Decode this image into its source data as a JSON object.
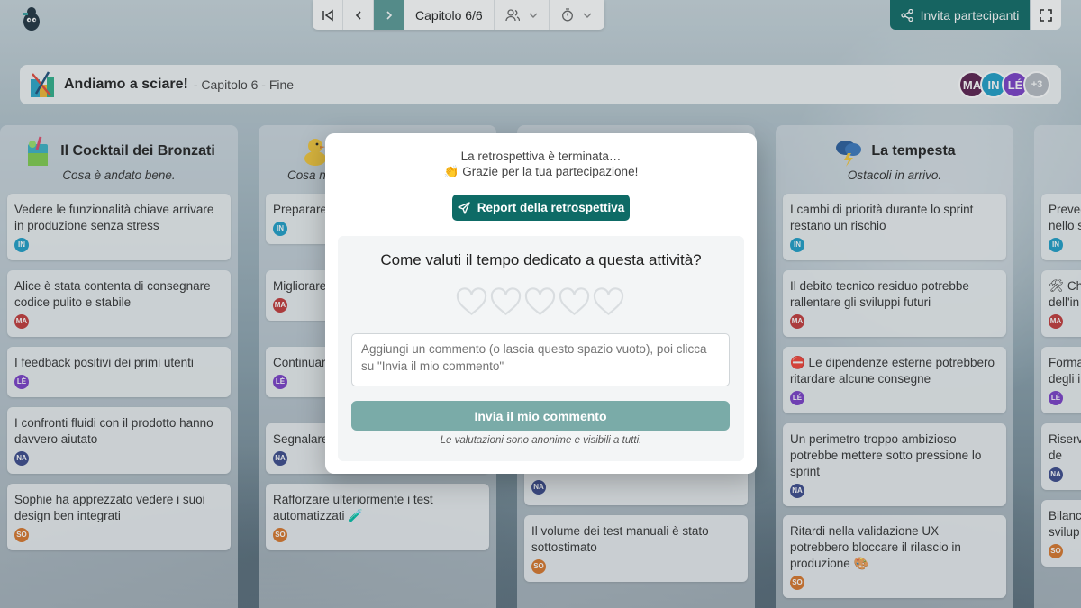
{
  "nav": {
    "chapter": "Capitolo 6/6",
    "invite_label": "Invita partecipanti"
  },
  "title": {
    "name": "Andiamo a sciare!",
    "subtitle": "- Capitolo 6 - Fine"
  },
  "participants": [
    "MA",
    "IN",
    "LÉ"
  ],
  "participants_more": "+3",
  "columns": [
    {
      "title": "Il Cocktail dei Bronzati",
      "subtitle": "Cosa è andato bene.",
      "cards": [
        {
          "text": "Vedere le funzionalità chiave arrivare in produzione senza stress",
          "author": "IN"
        },
        {
          "text": "Alice è stata contenta di consegnare codice pulito e stabile",
          "author": "MA"
        },
        {
          "text": "I feedback positivi dei primi utenti",
          "author": "LÉ"
        },
        {
          "text": "I confronti fluidi con il prodotto hanno davvero aiutato",
          "author": "NA"
        },
        {
          "text": "Sophie ha apprezzato vedere i suoi design ben integrati",
          "author": "SO"
        }
      ]
    },
    {
      "title": "",
      "subtitle": "Cosa n",
      "cards": [
        {
          "text": "Preparare prima del",
          "author": "IN"
        },
        {
          "text": "Migliorare trasversal",
          "author": "MA"
        },
        {
          "text": "Continuar in modo n",
          "author": "LÉ"
        },
        {
          "text": "Segnalare",
          "author": "NA"
        },
        {
          "text": "Rafforzare ulteriormente i test automatizzati 🧪",
          "author": "SO"
        }
      ]
    },
    {
      "title": "",
      "subtitle": "",
      "cards": [
        {
          "text": "",
          "author": "NA"
        },
        {
          "text": "Il volume dei test manuali è stato sottostimato",
          "author": "SO"
        }
      ]
    },
    {
      "title": "La tempesta",
      "subtitle": "Ostacoli in arrivo.",
      "cards": [
        {
          "text": "I cambi di priorità durante lo sprint restano un rischio",
          "author": "IN"
        },
        {
          "text": "Il debito tecnico residuo potrebbe rallentare gli sviluppi futuri",
          "author": "MA"
        },
        {
          "text": "⛔ Le dipendenze esterne potrebbero ritardare alcune consegne",
          "author": "LÉ"
        },
        {
          "text": "Un perimetro troppo ambizioso potrebbe mettere sotto pressione lo sprint",
          "author": "NA"
        },
        {
          "text": "Ritardi nella validazione UX potrebbero bloccare il rilascio in produzione 🎨",
          "author": "SO"
        }
      ]
    },
    {
      "title": "",
      "subtitle": "",
      "cards": [
        {
          "text": "Preved nello s",
          "author": "IN"
        },
        {
          "text": "🛠 Ch dell'in",
          "author": "MA"
        },
        {
          "text": "Forma degli i",
          "author": "LÉ"
        },
        {
          "text": "Riserv per de",
          "author": "NA"
        },
        {
          "text": "Bilanc svilup",
          "author": "SO"
        }
      ]
    }
  ],
  "modal": {
    "line1": "La retrospettiva è terminata…",
    "line2": "👏 Grazie per la tua partecipazione!",
    "report_label": "Report della retrospettiva",
    "question": "Come valuti il tempo dedicato a questa attività?",
    "rating": 0,
    "rating_max": 5,
    "comment_placeholder": "Aggiungi un commento (o lascia questo spazio vuoto), poi clicca su \"Invia il mio commento\"",
    "send_label": "Invia il mio commento",
    "note": "Le valutazioni sono anonime e visibili a tutti."
  },
  "colors": {
    "primary": "#0e6b66",
    "send_disabled": "#7aaba8",
    "avatar_MA": "#5b1f4f",
    "avatar_IN": "#1e9fc8",
    "avatar_LE": "#7a3fc9",
    "avatar_NA": "#3b4a8c",
    "avatar_SO": "#d9772b"
  }
}
